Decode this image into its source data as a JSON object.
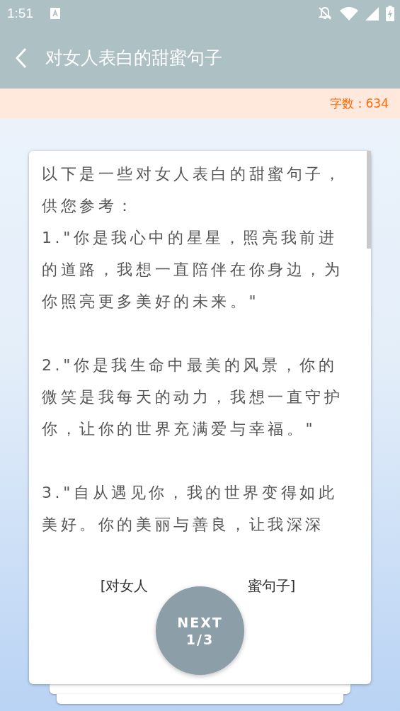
{
  "status_bar": {
    "time": "1:51"
  },
  "app_bar": {
    "title": "对女人表白的甜蜜句子"
  },
  "banner": {
    "word_count": "字数：634"
  },
  "content": {
    "paragraphs": [
      "以下是一些对女人表白的甜蜜句子，供您参考：",
      "1.\"你是我心中的星星，照亮我前进的道路，我想一直陪伴在你身边，为你照亮更多美好的未来。\"",
      "2.\"你是我生命中最美的风景，你的微笑是我每天的动力，我想一直守护你，让你的世界充满爱与幸福。\"",
      "3.\"自从遇见你，我的世界变得如此美好。你的美丽与善良，让我深深"
    ],
    "caption_left": "[对女人",
    "caption_right": "蜜句子]"
  },
  "next_button": {
    "label": "NEXT",
    "page": "1/3"
  }
}
